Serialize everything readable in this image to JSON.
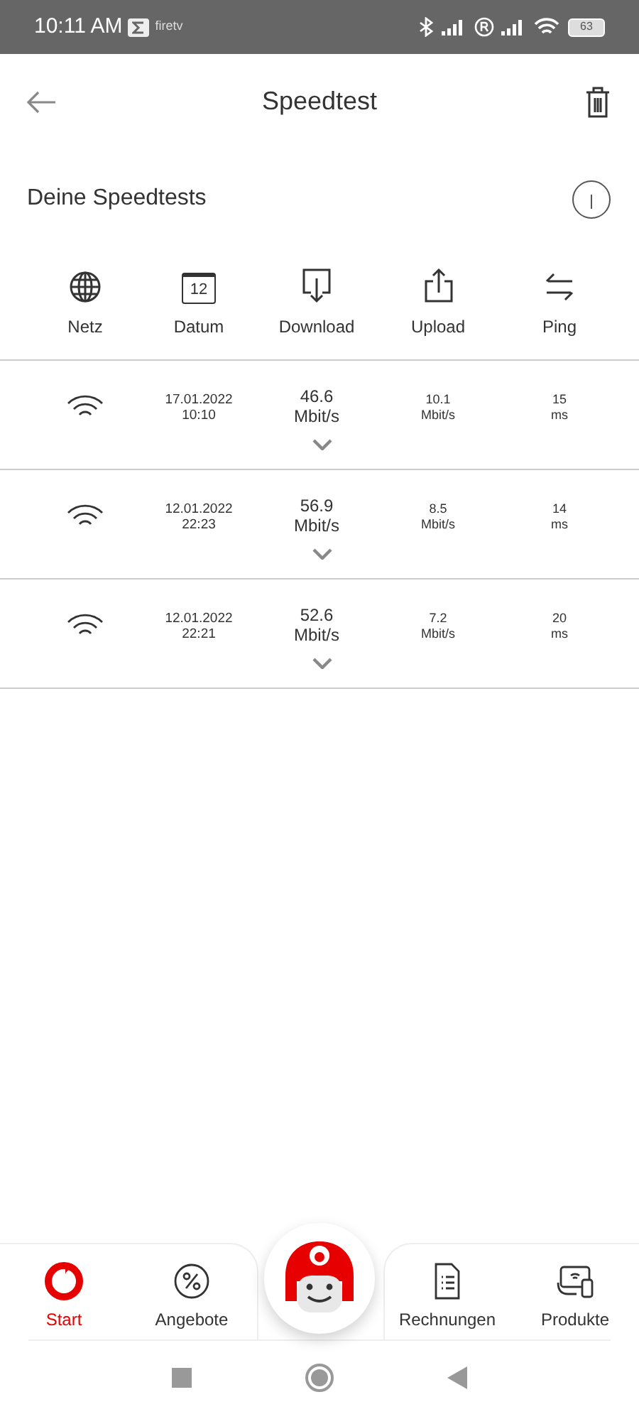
{
  "status_bar": {
    "time": "10:11 AM",
    "app_badge": "firetv",
    "battery": "63"
  },
  "header": {
    "title": "Speedtest"
  },
  "section": {
    "title": "Deine Speedtests"
  },
  "columns": [
    {
      "kind": "globe",
      "label": "Netz"
    },
    {
      "kind": "calendar",
      "label": "Datum",
      "calendar_day": "12"
    },
    {
      "kind": "download",
      "label": "Download"
    },
    {
      "kind": "upload",
      "label": "Upload"
    },
    {
      "kind": "ping",
      "label": "Ping"
    }
  ],
  "results": [
    {
      "date": "17.01.2022",
      "time": "10:10",
      "download": "46.6",
      "download_unit": "Mbit/s",
      "upload": "10.1",
      "upload_unit": "Mbit/s",
      "ping": "15",
      "ping_unit": "ms",
      "expanded": false
    },
    {
      "date": "12.01.2022",
      "time": "22:23",
      "download": "56.9",
      "download_unit": "Mbit/s",
      "upload": "8.5",
      "upload_unit": "Mbit/s",
      "ping": "14",
      "ping_unit": "ms",
      "expanded": false
    },
    {
      "date": "12.01.2022",
      "time": "22:21",
      "download": "52.6",
      "download_unit": "Mbit/s",
      "upload": "7.2",
      "upload_unit": "Mbit/s",
      "ping": "20",
      "ping_unit": "ms",
      "expanded": false
    }
  ],
  "bottom_nav": [
    {
      "kind": "start",
      "label": "Start",
      "selected": true
    },
    {
      "kind": "offers",
      "label": "Angebote",
      "selected": false
    },
    {
      "kind": "bills",
      "label": "Rechnungen",
      "selected": false
    },
    {
      "kind": "products",
      "label": "Produkte",
      "selected": false
    }
  ]
}
